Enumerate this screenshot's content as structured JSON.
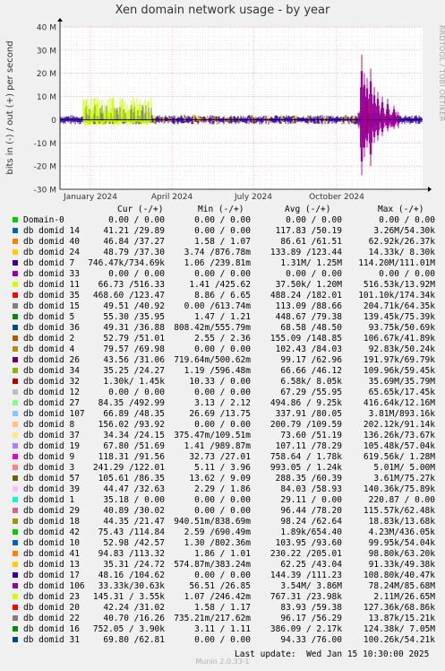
{
  "chart_data": {
    "type": "line",
    "title": "Xen domain network usage - by year",
    "ylabel": "bits in (-) / out (+) per second",
    "side_label": "RRDTOOL / TOBI OETIKER",
    "ylim": [
      -30000000,
      40000000
    ],
    "y_ticks": [
      {
        "v": 40000000,
        "label": "40 M"
      },
      {
        "v": 30000000,
        "label": "30 M"
      },
      {
        "v": 20000000,
        "label": "20 M"
      },
      {
        "v": 10000000,
        "label": "10 M"
      },
      {
        "v": 0,
        "label": "0"
      },
      {
        "v": -10000000,
        "label": "-10 M"
      },
      {
        "v": -20000000,
        "label": "-20 M"
      },
      {
        "v": -30000000,
        "label": "-30 M"
      }
    ],
    "x_ticks": [
      "January 2024",
      "April 2024",
      "July 2024",
      "October 2024"
    ],
    "grid": true,
    "legend_header": {
      "cur": "Cur (-/+)",
      "min": "Min (-/+)",
      "avg": "Avg (-/+)",
      "max": "Max (-/+)"
    },
    "series": [
      {
        "name": "Domain-0",
        "color": "#00cc00",
        "cur": "0.00 / 0.00",
        "min": "0.00 / 0.00",
        "avg": "0.00 / 0.00",
        "max": "0.00 / 0.00"
      },
      {
        "name": "db domid 14",
        "color": "#0066b3",
        "cur": "41.21 /29.89",
        "min": "0.00 / 0.00",
        "avg": "117.83 /50.19",
        "max": "3.26M/54.30k"
      },
      {
        "name": "db domid 40",
        "color": "#ff8000",
        "cur": "46.84 /37.27",
        "min": "1.58 / 1.07",
        "avg": "86.61 /61.51",
        "max": "62.92k/26.37k"
      },
      {
        "name": "db domid 24",
        "color": "#ffcc00",
        "cur": "48.79 /37.30",
        "min": "3.74 /876.78m",
        "avg": "133.89 /123.44",
        "max": "14.33k/ 8.30k"
      },
      {
        "name": "db domid 7",
        "color": "#330099",
        "cur": "746.47k/734.69k",
        "min": "1.06 /239.81m",
        "avg": "1.31M/ 1.25M",
        "max": "114.20M/111.01M"
      },
      {
        "name": "db domid 33",
        "color": "#990099",
        "cur": "0.00 / 0.00",
        "min": "0.00 / 0.00",
        "avg": "0.00 / 0.00",
        "max": "0.00 / 0.00"
      },
      {
        "name": "db domid 11",
        "color": "#ccff00",
        "cur": "66.73 /516.33",
        "min": "1.41 /425.62",
        "avg": "37.50k/ 1.20M",
        "max": "516.53k/13.92M"
      },
      {
        "name": "db domid 35",
        "color": "#ff0000",
        "cur": "468.60 /123.47",
        "min": "8.86 / 6.65",
        "avg": "488.24 /182.01",
        "max": "101.10k/174.34k"
      },
      {
        "name": "db domid 15",
        "color": "#808080",
        "cur": "49.51 /40.92",
        "min": "0.00 /613.74m",
        "avg": "113.09 /88.66",
        "max": "204.71k/64.35k"
      },
      {
        "name": "db domid 5",
        "color": "#008f00",
        "cur": "55.30 /35.95",
        "min": "1.47 / 1.21",
        "avg": "448.67 /79.38",
        "max": "139.45k/75.39k"
      },
      {
        "name": "db domid 36",
        "color": "#00487d",
        "cur": "49.31 /36.88",
        "min": "808.42m/555.79m",
        "avg": "68.58 /48.50",
        "max": "93.75k/50.69k"
      },
      {
        "name": "db domid 2",
        "color": "#b35a00",
        "cur": "52.79 /51.01",
        "min": "2.55 / 2.36",
        "avg": "155.09 /148.85",
        "max": "106.67k/41.89k"
      },
      {
        "name": "db domid 4",
        "color": "#b38f00",
        "cur": "79.57 /69.98",
        "min": "0.00 / 0.00",
        "avg": "102.43 /84.03",
        "max": "92.83k/50.24k"
      },
      {
        "name": "db domid 26",
        "color": "#6b006b",
        "cur": "43.56 /31.06",
        "min": "719.64m/500.62m",
        "avg": "99.17 /62.96",
        "max": "191.97k/69.79k"
      },
      {
        "name": "db domid 34",
        "color": "#8fb300",
        "cur": "35.25 /24.27",
        "min": "1.19 /596.48m",
        "avg": "66.66 /46.12",
        "max": "109.96k/59.45k"
      },
      {
        "name": "db domid 32",
        "color": "#b30000",
        "cur": "1.30k/ 1.45k",
        "min": "10.33 / 0.00",
        "avg": "6.58k/ 8.05k",
        "max": "35.69M/35.79M"
      },
      {
        "name": "db domid 12",
        "color": "#bebebe",
        "cur": "0.00 / 0.00",
        "min": "0.00 / 0.00",
        "avg": "67.29 /55.95",
        "max": "65.65k/17.45k"
      },
      {
        "name": "db domid 27",
        "color": "#80ff80",
        "cur": "84.35 /492.99",
        "min": "3.13 / 2.12",
        "avg": "494.86 / 9.25k",
        "max": "416.64k/12.16M"
      },
      {
        "name": "db domid 107",
        "color": "#80c9ff",
        "cur": "66.89 /48.35",
        "min": "26.69 /13.75",
        "avg": "337.91 /80.05",
        "max": "3.81M/893.16k"
      },
      {
        "name": "db domid 8",
        "color": "#ffc080",
        "cur": "156.02 /93.92",
        "min": "0.00 / 0.00",
        "avg": "200.79 /109.59",
        "max": "202.12k/91.14k"
      },
      {
        "name": "db domid 37",
        "color": "#ffe680",
        "cur": "34.34 /24.15",
        "min": "375.47m/109.51m",
        "avg": "73.60 /51.19",
        "max": "136.26k/73.67k"
      },
      {
        "name": "db domid 19",
        "color": "#aa80ff",
        "cur": "67.80 /51.69",
        "min": "1.41 /989.87m",
        "avg": "107.11 /78.29",
        "max": "105.48k/57.04k"
      },
      {
        "name": "db domid 9",
        "color": "#ee00cc",
        "cur": "118.31 /91.56",
        "min": "32.73 /27.01",
        "avg": "758.64 / 1.78k",
        "max": "619.56k/ 1.28M"
      },
      {
        "name": "db domid 3",
        "color": "#ff8080",
        "cur": "241.29 /122.01",
        "min": "5.11 / 3.96",
        "avg": "993.05 / 1.24k",
        "max": "5.01M/ 5.00M"
      },
      {
        "name": "db domid 57",
        "color": "#666600",
        "cur": "105.61 /86.35",
        "min": "13.62 / 9.09",
        "avg": "288.35 /60.39",
        "max": "3.61M/75.27k"
      },
      {
        "name": "db domid 39",
        "color": "#ffbfff",
        "cur": "44.47 /32.63",
        "min": "2.29 / 1.86",
        "avg": "84.03 /58.93",
        "max": "140.36k/75.89k"
      },
      {
        "name": "db domid 1",
        "color": "#00ffcc",
        "cur": "35.18 / 0.00",
        "min": "0.00 / 0.00",
        "avg": "29.11 / 0.00",
        "max": "220.87 / 0.00"
      },
      {
        "name": "db domid 29",
        "color": "#cc6699",
        "cur": "40.89 /30.02",
        "min": "0.00 / 0.00",
        "avg": "96.44 /78.20",
        "max": "115.57k/62.48k"
      },
      {
        "name": "db domid 18",
        "color": "#999900",
        "cur": "44.35 /21.47",
        "min": "940.51m/838.69m",
        "avg": "98.24 /62.64",
        "max": "18.83k/13.68k"
      },
      {
        "name": "db domid 42",
        "color": "#00cc00",
        "cur": "75.43 /114.84",
        "min": "2.59 /690.49m",
        "avg": "1.89k/654.40",
        "max": "4.23M/436.05k"
      },
      {
        "name": "db domid 10",
        "color": "#0066b3",
        "cur": "52.98 /42.57",
        "min": "1.30 /802.36m",
        "avg": "103.95 /93.60",
        "max": "99.95k/54.04k"
      },
      {
        "name": "db domid 41",
        "color": "#ff8000",
        "cur": "94.83 /113.32",
        "min": "1.86 / 1.01",
        "avg": "230.22 /205.01",
        "max": "98.80k/63.20k"
      },
      {
        "name": "db domid 13",
        "color": "#ffcc00",
        "cur": "35.31 /24.72",
        "min": "574.87m/383.24m",
        "avg": "62.25 /43.04",
        "max": "91.33k/49.38k"
      },
      {
        "name": "db domid 17",
        "color": "#330099",
        "cur": "48.16 /104.62",
        "min": "0.00 / 0.00",
        "avg": "144.39 /111.23",
        "max": "108.80k/40.47k"
      },
      {
        "name": "db domid 106",
        "color": "#990099",
        "cur": "33.33k/30.63k",
        "min": "56.51 /26.85",
        "avg": "3.54M/ 3.86M",
        "max": "78.24M/85.68M"
      },
      {
        "name": "db domid 23",
        "color": "#ccff00",
        "cur": "145.31 / 3.55k",
        "min": "1.07 /246.42m",
        "avg": "767.31 /23.98k",
        "max": "2.11M/26.65M"
      },
      {
        "name": "db domid 20",
        "color": "#ff0000",
        "cur": "42.24 /31.02",
        "min": "1.58 / 1.17",
        "avg": "83.93 /59.38",
        "max": "127.36k/68.86k"
      },
      {
        "name": "db domid 22",
        "color": "#808080",
        "cur": "40.70 /16.26",
        "min": "735.21m/217.62m",
        "avg": "96.17 /56.29",
        "max": "13.87k/15.21k"
      },
      {
        "name": "db domid 16",
        "color": "#008f00",
        "cur": "752.05 / 3.90k",
        "min": "3.11 / 1.11",
        "avg": "386.09 / 2.17k",
        "max": "124.38k/ 7.05M"
      },
      {
        "name": "db domid 31",
        "color": "#00487d",
        "cur": "69.80 /62.81",
        "min": "0.00 / 0.00",
        "avg": "94.33 /76.00",
        "max": "100.26k/54.21k"
      }
    ],
    "last_update": "Last update:  Wed Jan 15 10:30:00 2025",
    "footer": "Munin 2.0.33-1"
  }
}
